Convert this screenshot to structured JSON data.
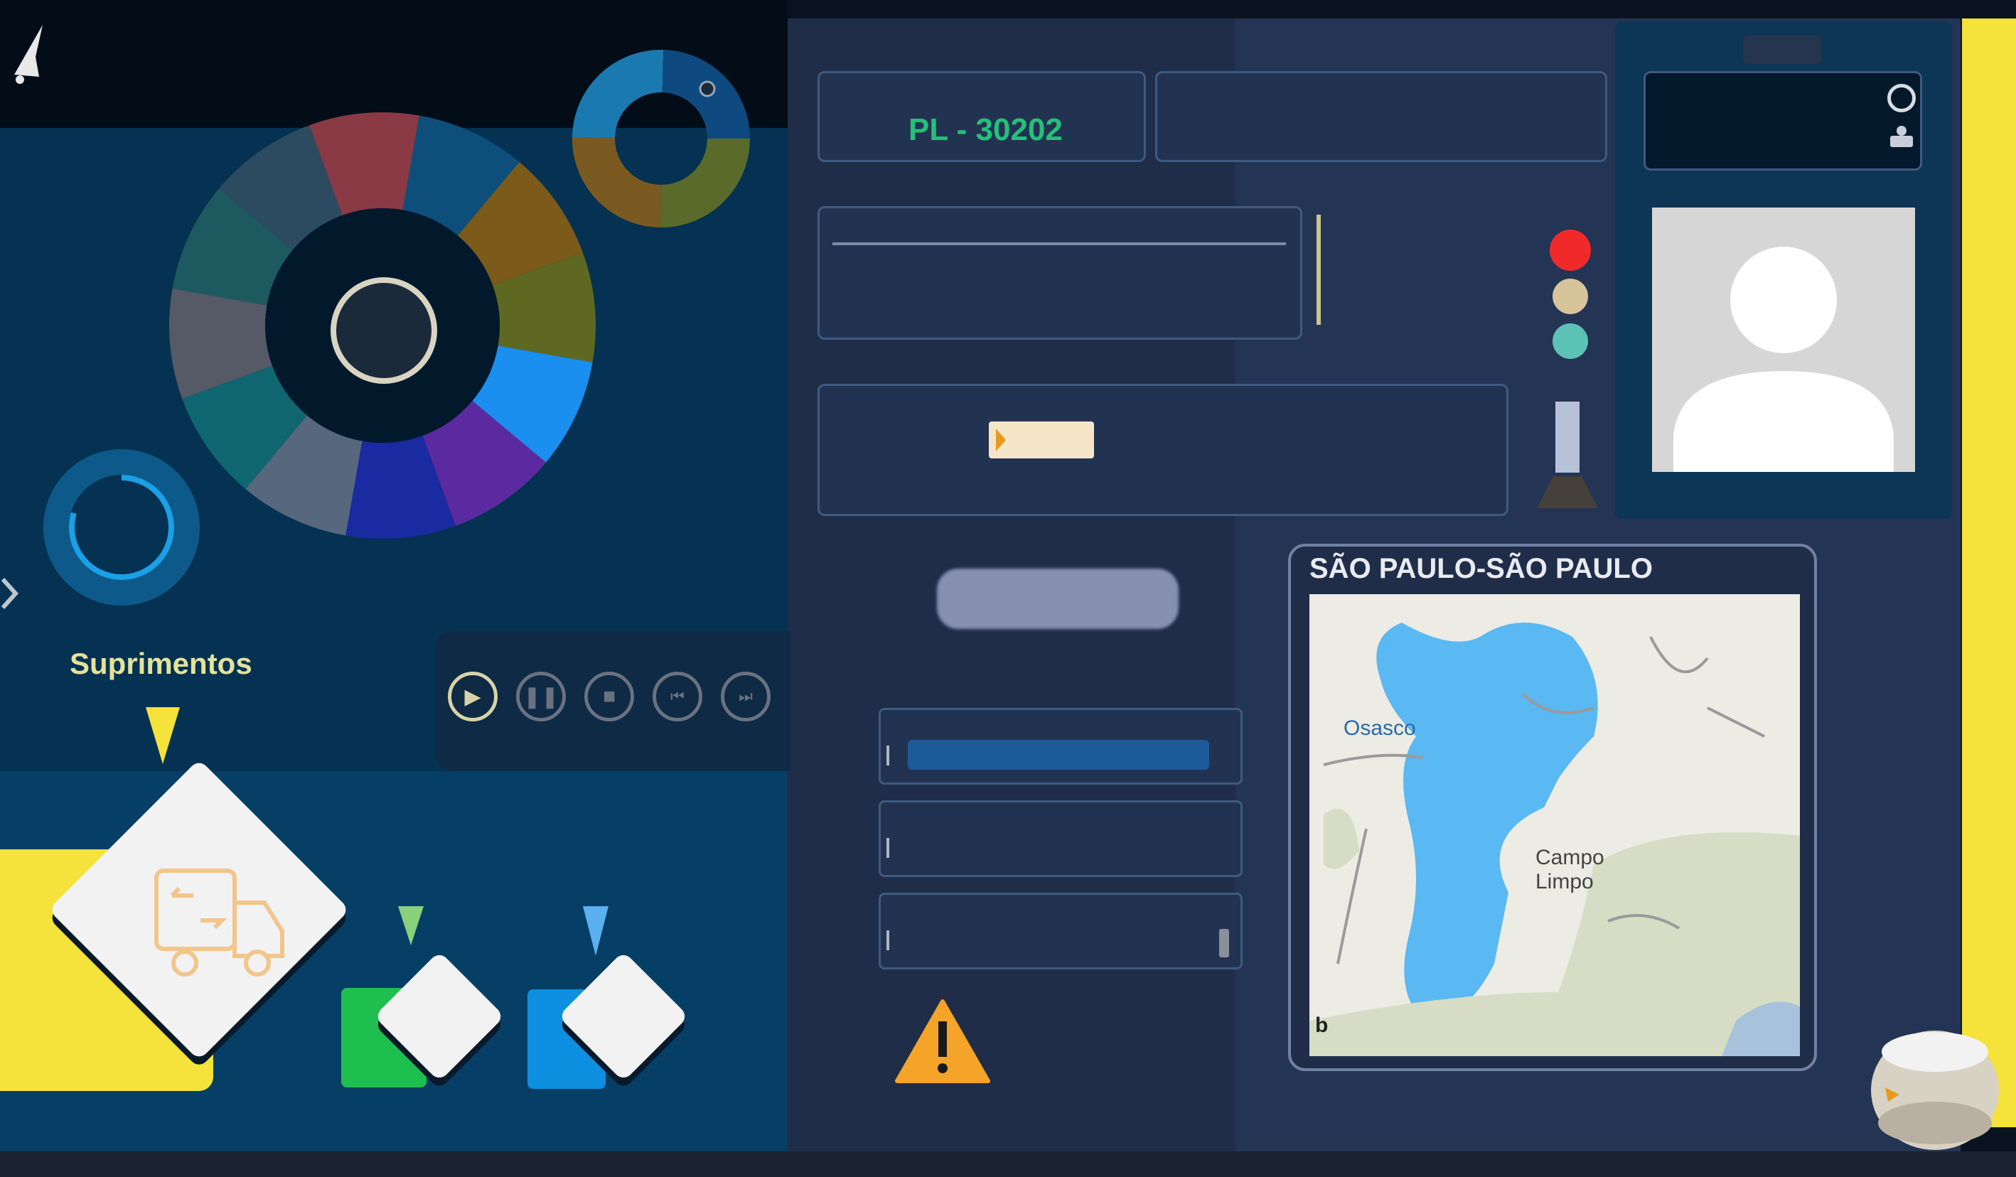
{
  "nav": {
    "bell_icon": "bell-icon",
    "side_arrow_icon": "chevron-left-icon"
  },
  "donut_menu": {
    "center_label": "",
    "segments": [
      {
        "label": "",
        "color": "#8a3a44"
      },
      {
        "label": "",
        "color": "#0d4f7a"
      },
      {
        "label": "",
        "color": "#7c5a1a"
      },
      {
        "label": "",
        "color": "#5f6820"
      },
      {
        "label": "",
        "color": "#1b8ff0"
      },
      {
        "label": "",
        "color": "#5c2aa0"
      },
      {
        "label": "",
        "color": "#1a2aa0"
      },
      {
        "label": "",
        "color": "#56677e"
      },
      {
        "label": "",
        "color": "#0f6670"
      },
      {
        "label": "",
        "color": "#555a66"
      },
      {
        "label": "",
        "color": "#1d5a60"
      },
      {
        "label": "",
        "color": "#2c4a60"
      }
    ]
  },
  "mini_donut": {
    "label_top": "",
    "label_right": "",
    "colors": [
      "#5a6a2a",
      "#7a5a20",
      "#1a7ab0",
      "#0e4a80"
    ]
  },
  "progress_ring": {
    "value": 0.8
  },
  "workflow": {
    "title": "Suprimentos",
    "main_step_icon": "delivery-truck-icon",
    "step_colors": [
      "#f5e23a",
      "#1fbf4f",
      "#0f8fe0"
    ],
    "step_labels": [
      "",
      ""
    ]
  },
  "media_controls": {
    "buttons": [
      "play-icon",
      "pause-icon",
      "stop-icon",
      "skip-back-icon",
      "skip-forward-icon"
    ]
  },
  "header": {
    "id_label": "",
    "id_value": "PL - 30202",
    "field2_label": "",
    "field2_value": "",
    "user_label": "",
    "user_value": ""
  },
  "process": {
    "label": "",
    "value": "",
    "status_lines": [
      "",
      "",
      ""
    ],
    "traffic_light": [
      "#f02a2a",
      "#d8c49a",
      "#5cc2b6"
    ]
  },
  "comments": {
    "label": "",
    "line1": "",
    "line2": ""
  },
  "form": {
    "fields": [
      {
        "label": "",
        "value": ""
      },
      {
        "label": "",
        "value": ""
      },
      {
        "label": "",
        "value": ""
      }
    ]
  },
  "warning": {
    "text_lines": [
      "",
      "",
      ""
    ]
  },
  "map": {
    "title": "SÃO PAULO-SÃO PAULO",
    "places": [
      "Osasco",
      "Campo Limpo"
    ]
  },
  "profile": {
    "photo_alt": "avatar-placeholder"
  },
  "colors": {
    "accent_yellow": "#f5e23a",
    "panel": "#243454",
    "dark": "#04192c",
    "green_text": "#25c07a"
  }
}
